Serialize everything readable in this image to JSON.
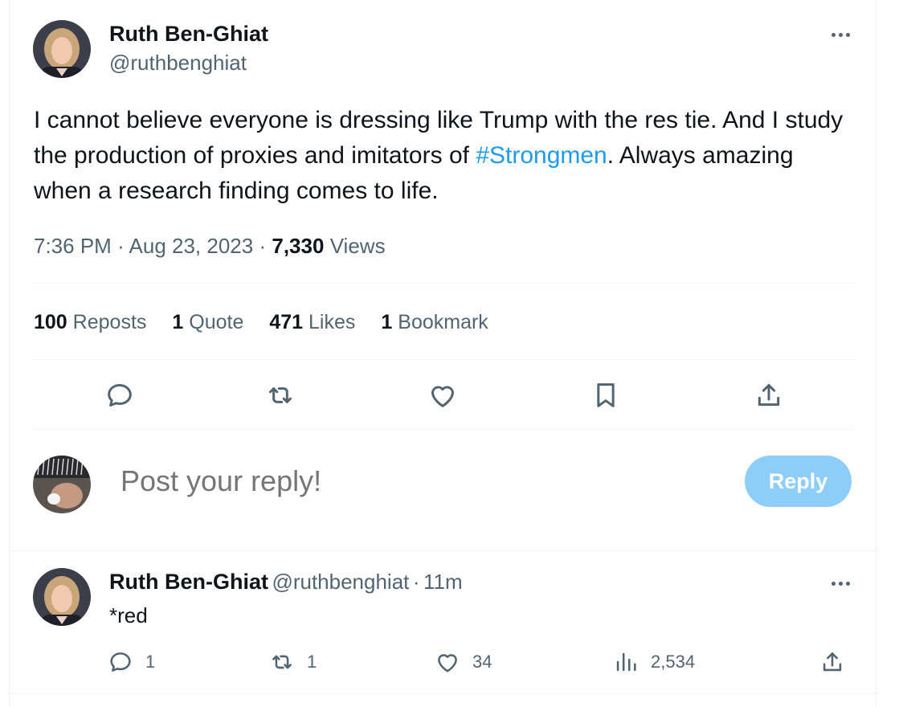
{
  "tweet": {
    "author_name": "Ruth Ben-Ghiat",
    "author_handle": "@ruthbenghiat",
    "text_before": "I cannot believe everyone is dressing like Trump with the res tie. And I study the production of proxies and imitators of ",
    "hashtag": "#Strongmen",
    "text_after": ". Always amazing when a research finding comes to life.",
    "time": "7:36 PM",
    "date": "Aug 23, 2023",
    "views_count": "7,330",
    "views_label": "Views",
    "separator": "·"
  },
  "stats": [
    {
      "count": "100",
      "label": "Reposts"
    },
    {
      "count": "1",
      "label": "Quote"
    },
    {
      "count": "471",
      "label": "Likes"
    },
    {
      "count": "1",
      "label": "Bookmark"
    }
  ],
  "composer": {
    "placeholder": "Post your reply!",
    "button_label": "Reply"
  },
  "reply": {
    "author_name": "Ruth Ben-Ghiat",
    "author_handle": "@ruthbenghiat",
    "separator": "·",
    "age": "11m",
    "text": "*red",
    "reply_count": "1",
    "repost_count": "1",
    "like_count": "34",
    "view_count": "2,534"
  },
  "colors": {
    "accent": "#1d9bf0",
    "reply_button_disabled": "#8ecdf8",
    "secondary_text": "#536471"
  },
  "icons": {
    "main_actions": [
      "reply-icon",
      "repost-icon",
      "like-icon",
      "bookmark-icon",
      "share-icon"
    ],
    "reply_actions": [
      "reply-icon",
      "repost-icon",
      "like-icon",
      "views-icon",
      "share-icon"
    ]
  }
}
